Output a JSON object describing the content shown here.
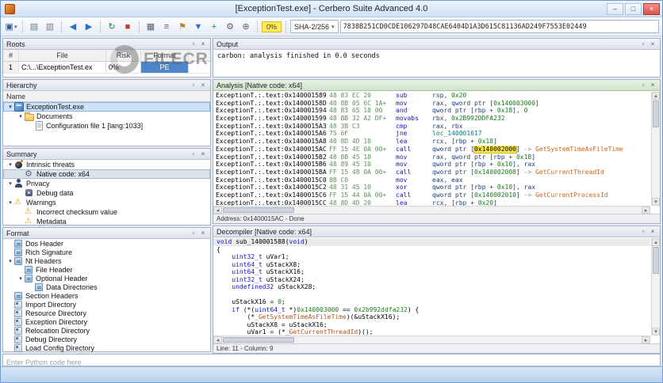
{
  "window": {
    "title": "[ExceptionTest.exe] - Cerbero Suite Advanced 4.0",
    "buttons": {
      "minimize": "–",
      "maximize": "□",
      "close": "×"
    }
  },
  "colors": {
    "accent_blue": "#3a78c2",
    "close_button": "#d9534f",
    "risk_badge_bg": "#ffe95e",
    "highlight_bg": "#ffe84a",
    "mnemonic": "#1414c8",
    "number_green": "#1a7a1a",
    "bytes_green": "#5f8f5f",
    "api_orange": "#c8651b",
    "selection_bg": "#cfe3f8",
    "analysis_header_green": "#d0e5cc"
  },
  "watermark": {
    "text": "FILECR"
  },
  "toolbar": {
    "items": [
      {
        "type": "icon",
        "name": "save-icon",
        "glyph": "▣",
        "color": "#2a5fa8",
        "caret": true
      },
      {
        "type": "sep"
      },
      {
        "type": "icon",
        "name": "open-file-icon",
        "glyph": "▤",
        "color": "#6b7c92"
      },
      {
        "type": "icon",
        "name": "report-icon",
        "glyph": "▥",
        "color": "#6b7c92"
      },
      {
        "type": "sep"
      },
      {
        "type": "icon",
        "name": "back-icon",
        "glyph": "◀",
        "color": "#2a6fc0"
      },
      {
        "type": "icon",
        "name": "forward-icon",
        "glyph": "▶",
        "color": "#2a6fc0"
      },
      {
        "type": "sep"
      },
      {
        "type": "icon",
        "name": "reanalyze-icon",
        "glyph": "↻",
        "color": "#1f8a3b"
      },
      {
        "type": "icon",
        "name": "stop-icon",
        "glyph": "■",
        "color": "#c03a2b"
      },
      {
        "type": "sep"
      },
      {
        "type": "icon",
        "name": "hex-view-icon",
        "glyph": "▦",
        "color": "#55637a"
      },
      {
        "type": "icon",
        "name": "text-view-icon",
        "glyph": "≡",
        "color": "#55637a"
      },
      {
        "type": "icon",
        "name": "bookmarks-icon",
        "glyph": "⚑",
        "color": "#c07a2a"
      },
      {
        "type": "icon",
        "name": "filter-icon",
        "glyph": "▼",
        "color": "#2a6fc0"
      },
      {
        "type": "icon",
        "name": "add-extension-icon",
        "glyph": "+",
        "color": "#1f8a3b"
      },
      {
        "type": "icon",
        "name": "settings-icon",
        "glyph": "⚙",
        "color": "#55637a"
      },
      {
        "type": "icon",
        "name": "search-icon",
        "glyph": "⊕",
        "color": "#55637a"
      },
      {
        "type": "sep"
      },
      {
        "type": "badge",
        "name": "risk-score-badge",
        "label": "0%"
      },
      {
        "type": "sep"
      },
      {
        "type": "select",
        "name": "hash-algo-select",
        "label": "SHA-2/256"
      },
      {
        "type": "input",
        "name": "hash-value-field",
        "value": "7838B251CD0CDE106297D48CAE6404D1A3D615C81136AD249F7553E02449"
      }
    ]
  },
  "roots": {
    "title": "Roots",
    "columns": [
      "#",
      "File",
      "Risk",
      "Format"
    ],
    "rows": [
      {
        "num": "1",
        "file": "C:\\...\\ExceptionTest.ex",
        "risk": "0%",
        "format": "PE"
      }
    ]
  },
  "output": {
    "title": "Output",
    "text": "carbon: analysis finished in 0.0 seconds"
  },
  "hierarchy": {
    "title": "Hierarchy",
    "column_header": "Name",
    "items": [
      {
        "label": "ExceptionTest.exe",
        "level": 0,
        "icon": "pe-file-icon",
        "caret": true,
        "selected": true
      },
      {
        "label": "Documents",
        "level": 1,
        "icon": "folder-icon",
        "caret": true
      },
      {
        "label": "Configuration file 1 [lang:1033]",
        "level": 2,
        "icon": "config-file-icon"
      }
    ]
  },
  "summary": {
    "title": "Summary",
    "items": [
      {
        "label": "Intrinsic threats",
        "level": 0,
        "icon": "bomb-icon",
        "caret": true
      },
      {
        "label": "Native code: x64",
        "level": 1,
        "icon": "gear-icon",
        "selected_gray": true
      },
      {
        "label": "Privacy",
        "level": 0,
        "icon": "person-icon",
        "caret": true
      },
      {
        "label": "Debug data",
        "level": 1,
        "icon": "debug-icon"
      },
      {
        "label": "Warnings",
        "level": 0,
        "icon": "warning-icon",
        "caret": true
      },
      {
        "label": "Incorrect checksum value",
        "level": 1,
        "icon": "warning-icon"
      },
      {
        "label": "Metadata",
        "level": 1,
        "icon": "warning-icon"
      }
    ]
  },
  "format_panel": {
    "title": "Format",
    "items": [
      {
        "label": "Dos Header",
        "level": 0,
        "icon": "header-icon"
      },
      {
        "label": "Rich Signature",
        "level": 0,
        "icon": "header-icon"
      },
      {
        "label": "Nt Headers",
        "level": 0,
        "icon": "header-icon",
        "caret": true
      },
      {
        "label": "File Header",
        "level": 1,
        "icon": "header-icon"
      },
      {
        "label": "Optional Header",
        "level": 1,
        "icon": "header-icon",
        "caret": true
      },
      {
        "label": "Data Directories",
        "level": 2,
        "icon": "header-icon"
      },
      {
        "label": "Section Headers",
        "level": 0,
        "icon": "header-icon"
      },
      {
        "label": "Import Directory",
        "level": 0,
        "icon": "directory-icon"
      },
      {
        "label": "Resource Directory",
        "level": 0,
        "icon": "directory-icon"
      },
      {
        "label": "Exception Directory",
        "level": 0,
        "icon": "directory-icon"
      },
      {
        "label": "Relocation Directory",
        "level": 0,
        "icon": "directory-icon"
      },
      {
        "label": "Debug Directory",
        "level": 0,
        "icon": "directory-icon"
      },
      {
        "label": "Load Config Directory",
        "level": 0,
        "icon": "directory-icon"
      }
    ]
  },
  "analysis": {
    "title": "Analysis [Native code: x64]",
    "address_status": "Address: 0x1400015AC - Done",
    "rows": [
      {
        "addr": "ExceptionT.:.text:0x140001589",
        "bytes": "48 83 EC 20",
        "mn": "sub",
        "ops": "rsp, 0x20"
      },
      {
        "addr": "ExceptionT.:.text:0x14000158D",
        "bytes": "48 8B 05 6C 1A+",
        "mn": "mov",
        "ops": "rax, qword ptr [0x140003000]"
      },
      {
        "addr": "ExceptionT.:.text:0x140001594",
        "bytes": "48 83 65 18 00",
        "mn": "and",
        "ops": "qword ptr [rbp + 0x18], 0"
      },
      {
        "addr": "ExceptionT.:.text:0x140001599",
        "bytes": "48 BB 32 A2 DF+",
        "mn": "movabs",
        "ops": "rbx, 0x2B992DDFA232"
      },
      {
        "addr": "ExceptionT.:.text:0x1400015A3",
        "bytes": "48 3B C3",
        "mn": "cmp",
        "ops": "rax, rbx"
      },
      {
        "addr": "ExceptionT.:.text:0x1400015A6",
        "bytes": "75 6F",
        "mn": "jne",
        "ops": "loc_140001617"
      },
      {
        "addr": "ExceptionT.:.text:0x1400015A8",
        "bytes": "48 8D 4D 18",
        "mn": "lea",
        "ops": "rcx, [rbp + 0x18]"
      },
      {
        "addr": "ExceptionT.:.text:0x1400015AC",
        "bytes": "FF 15 4E 0A 00+",
        "mn": "call",
        "ops_pre": "qword ptr [",
        "hl": "0x140002000",
        "ops_post": "]",
        "api": "GetSystemTimeAsFileTime"
      },
      {
        "addr": "ExceptionT.:.text:0x1400015B2",
        "bytes": "48 8B 45 18",
        "mn": "mov",
        "ops": "rax, qword ptr [rbp + 0x18]"
      },
      {
        "addr": "ExceptionT.:.text:0x1400015B6",
        "bytes": "48 89 45 10",
        "mn": "mov",
        "ops": "qword ptr [rbp + 0x10], rax"
      },
      {
        "addr": "ExceptionT.:.text:0x1400015BA",
        "bytes": "FF 15 48 0A 00+",
        "mn": "call",
        "ops": "qword ptr [0x140002008]",
        "api": "GetCurrentThreadId"
      },
      {
        "addr": "ExceptionT.:.text:0x1400015C0",
        "bytes": "8B C0",
        "mn": "mov",
        "ops": "eax, eax"
      },
      {
        "addr": "ExceptionT.:.text:0x1400015C2",
        "bytes": "48 31 45 10",
        "mn": "xor",
        "ops": "qword ptr [rbp + 0x10], rax"
      },
      {
        "addr": "ExceptionT.:.text:0x1400015C6",
        "bytes": "FF 15 44 0A 00+",
        "mn": "call",
        "ops": "qword ptr [0x140002010]",
        "api": "GetCurrentProcessId"
      },
      {
        "addr": "ExceptionT.:.text:0x1400015CC",
        "bytes": "48 8D 4D 20",
        "mn": "lea",
        "ops": "rcx, [rbp + 0x20]"
      }
    ]
  },
  "decompiler": {
    "title": "Decompiler [Native code: x64]",
    "cursor_status": "Line: 11 - Column: 9",
    "highlight_line": 1,
    "lines": [
      "void sub_140001588(void)",
      "{",
      "    uint32_t uVar1;",
      "    uint64_t uStackX8;",
      "    uint64_t uStackX16;",
      "    uint32_t uStackX24;",
      "    undefined32 uStackX28;",
      "",
      "    uStackX16 = 0;",
      "    if (*(uint64_t *)0x140003000 == 0x2b992ddfa232) {",
      "        (*_GetSystemTimeAsFileTime)(&uStackX16);",
      "        uStackX8 = uStackX16;",
      "        uVar1 = (*_GetCurrentThreadId)();"
    ]
  },
  "python_console": {
    "placeholder": "Enter Python code here"
  }
}
